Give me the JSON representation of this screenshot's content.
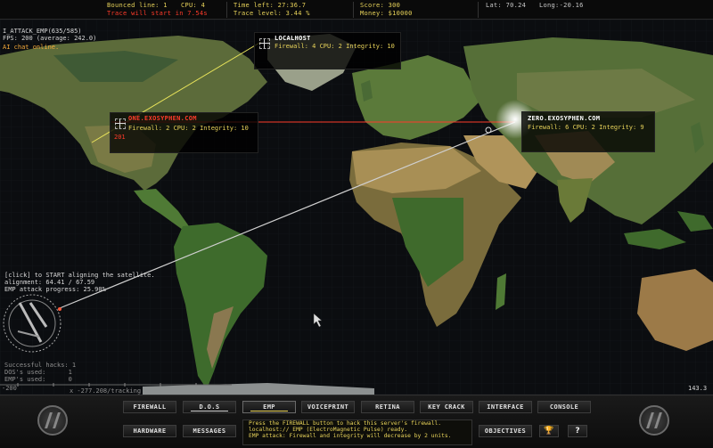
{
  "top_bar": {
    "bounced_line": "Bounced line: 1",
    "cpu": "CPU: 4",
    "trace_starts": "Trace will start in 7.54s",
    "time_left": "Time left: 27:36.7",
    "trace_level": "Trace level: 3.44 %",
    "score": "Score: 300",
    "money": "Money: $10000",
    "lat": "Lat: 70.24",
    "long": "Long:-20.16"
  },
  "hud": {
    "title": "I_ATTACK_EMP(635/585)",
    "fps": "FPS: 200 (average: 242.0)",
    "ai_chat": "AI chat online.",
    "sat_line1": "[click] to START aligning the satellite.",
    "sat_line2": "alignment: 64.41 / 67.59",
    "sat_line3": "EMP attack progress: 25.90%",
    "stats1": "Successful hacks: 1",
    "stats2": "DOS's used:      1",
    "stats3": "EMP's used:      0",
    "scale_left": "-200",
    "scale_mid": "x -277.208/tracking",
    "scale_right": "143.3"
  },
  "servers": {
    "localhost": {
      "name": "LOCALHOST",
      "info": "Firewall: 4 CPU: 2 Integrity: 10"
    },
    "one": {
      "name": "ONE.EXOSYPHEN.COM",
      "info": "Firewall: 2 CPU: 2 Integrity: 10",
      "tag": "201"
    },
    "zero": {
      "name": "ZERO.EXOSYPHEN.COM",
      "info": "Firewall: 6 CPU: 2 Integrity: 9"
    }
  },
  "buttons": {
    "firewall": "FIREWALL",
    "dos": "D.O.S",
    "emp": "EMP",
    "voiceprint": "VOICEPRINT",
    "retina": "RETINA",
    "key_crack": "KEY CRACK",
    "interface": "INTERFACE",
    "console": "CONSOLE",
    "hardware": "HARDWARE",
    "messages": "MESSAGES",
    "objectives": "OBJECTIVES",
    "help": "?"
  },
  "messages": [
    "Press the FIREWALL button to hack this server's firewall.",
    "localhost:// EMP (ElectroMagnetic Pulse) ready.",
    "EMP attack: Firewall and integrity will decrease by 2 units."
  ],
  "icons": {
    "trophy": "trophy-icon",
    "logo": "logo-icon"
  },
  "colors": {
    "yellow": "#e8d35a",
    "red": "#ff3b2a",
    "orange": "#f3a93a"
  }
}
